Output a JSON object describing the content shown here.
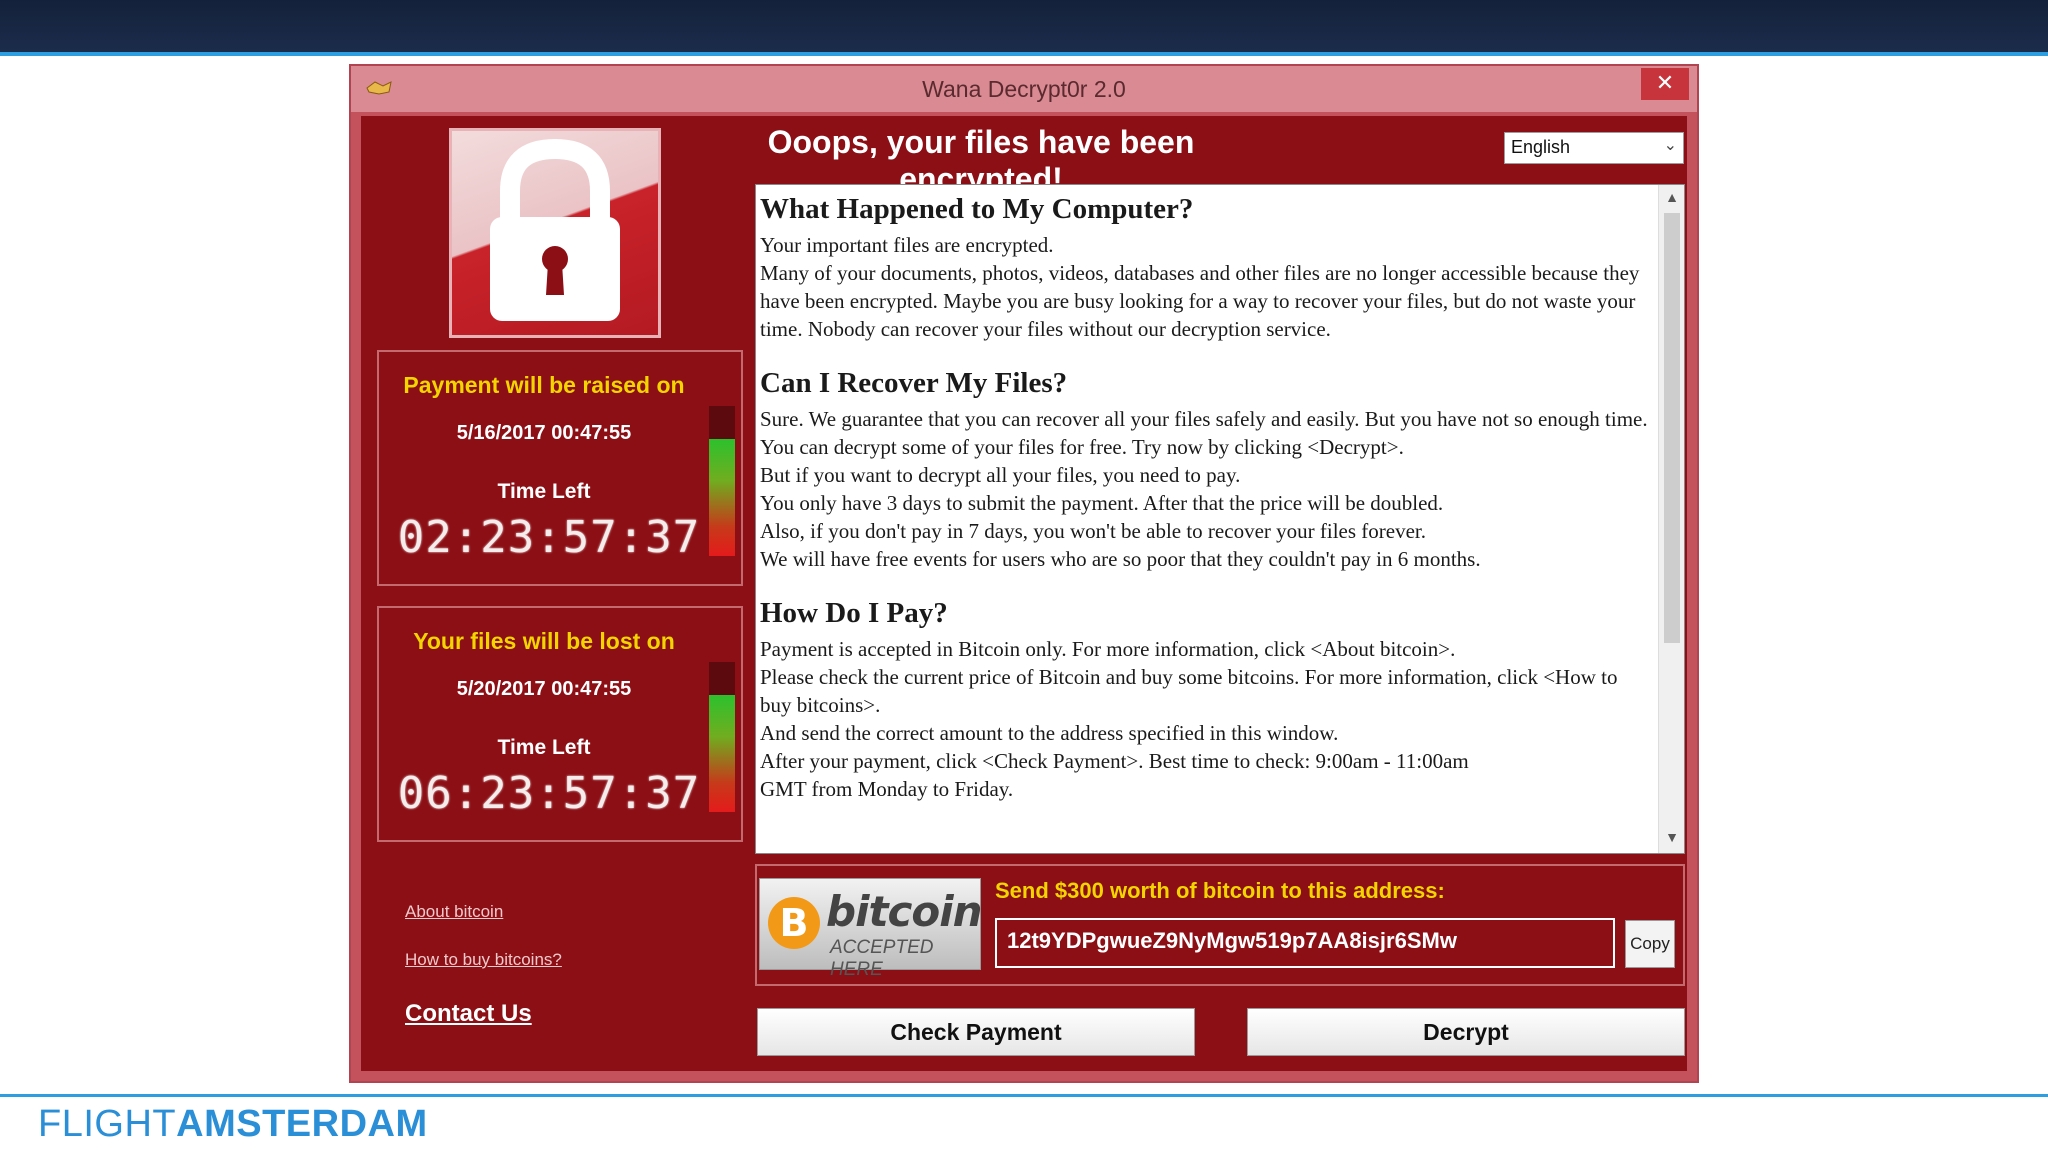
{
  "brand": {
    "part1": "FLIGHT",
    "part2": "AMSTERDAM",
    "color": "#2a8fd6"
  },
  "window": {
    "title": "Wana Decrypt0r 2.0",
    "close_label": "✕",
    "accent_color": "#8b0f15"
  },
  "header": {
    "headline": "Ooops, your files have been encrypted!",
    "language": "English"
  },
  "countdowns": [
    {
      "heading": "Payment will be raised on",
      "date": "5/16/2017 00:47:55",
      "time_left_label": "Time Left",
      "timer": "02:23:57:37",
      "level": 0.78
    },
    {
      "heading": "Your files will be lost on",
      "date": "5/20/2017 00:47:55",
      "time_left_label": "Time Left",
      "timer": "06:23:57:37",
      "level": 0.78
    }
  ],
  "links": {
    "about_bitcoin": "About bitcoin",
    "how_to_buy": "How to buy bitcoins?",
    "contact": "Contact Us"
  },
  "message": {
    "s1_title": "What Happened to My Computer?",
    "s1_p1": "Your important files are encrypted.",
    "s1_p2": "Many of your documents, photos, videos, databases and other files are no longer accessible because they have been encrypted. Maybe you are busy looking for a way to recover your files, but do not waste your time. Nobody can recover your files without our decryption service.",
    "s2_title": "Can I Recover My Files?",
    "s2_p1": "Sure. We guarantee that you can recover all your files safely and easily. But you have not so enough time.",
    "s2_p2": "You can decrypt some of your files for free. Try now by clicking <Decrypt>.",
    "s2_p3": "But if you want to decrypt all your files, you need to pay.",
    "s2_p4": "You only have 3 days to submit the payment. After that the price will be doubled.",
    "s2_p5": "Also, if you don't pay in 7 days, you won't be able to recover your files forever.",
    "s2_p6": "We will have free events for users who are so poor that they couldn't pay in 6 months.",
    "s3_title": "How Do I Pay?",
    "s3_p1": "Payment is accepted in Bitcoin only. For more information, click <About bitcoin>.",
    "s3_p2": "Please check the current price of Bitcoin and buy some bitcoins. For more information, click <How to buy bitcoins>.",
    "s3_p3": "And send the correct amount to the address specified in this window.",
    "s3_p4": "After your payment, click <Check Payment>. Best time to check: 9:00am - 11:00am",
    "s3_p5": "GMT from Monday to Friday."
  },
  "bitcoin": {
    "logo_symbol": "B",
    "logo_word": "bitcoin",
    "logo_sub": "ACCEPTED HERE",
    "send_label": "Send $300 worth of bitcoin to this address:",
    "address": "12t9YDPgwueZ9NyMgw519p7AA8isjr6SMw",
    "copy_label": "Copy"
  },
  "buttons": {
    "check_payment": "Check Payment",
    "decrypt": "Decrypt"
  }
}
